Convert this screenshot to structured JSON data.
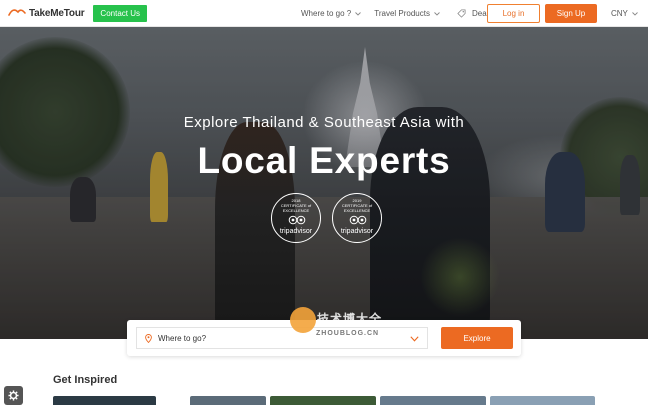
{
  "header": {
    "logo_text": "TakeMeTour",
    "contact_label": "Contact Us",
    "nav": {
      "where_label": "Where to go ?",
      "travel_label": "Travel Products",
      "deals_label": "Deals"
    },
    "login_label": "Log in",
    "signup_label": "Sign Up",
    "currency": "CNY"
  },
  "hero": {
    "subtitle": "Explore Thailand & Southeast Asia with",
    "title": "Local Experts",
    "badges": [
      {
        "year": "2018",
        "line1": "CERTIFICATE of",
        "line2": "EXCELLENCE",
        "brand": "tripadvisor"
      },
      {
        "year": "2019",
        "line1": "CERTIFICATE of",
        "line2": "EXCELLENCE",
        "brand": "tripadvisor"
      }
    ]
  },
  "search": {
    "placeholder": "Where to go?",
    "explore_label": "Explore"
  },
  "watermark": {
    "cn": "技术博大全",
    "en": "ZHOUBLOG.CN"
  },
  "section": {
    "get_inspired": "Get Inspired"
  },
  "colors": {
    "brand_orange": "#ec6a22",
    "contact_green": "#27c24c"
  }
}
